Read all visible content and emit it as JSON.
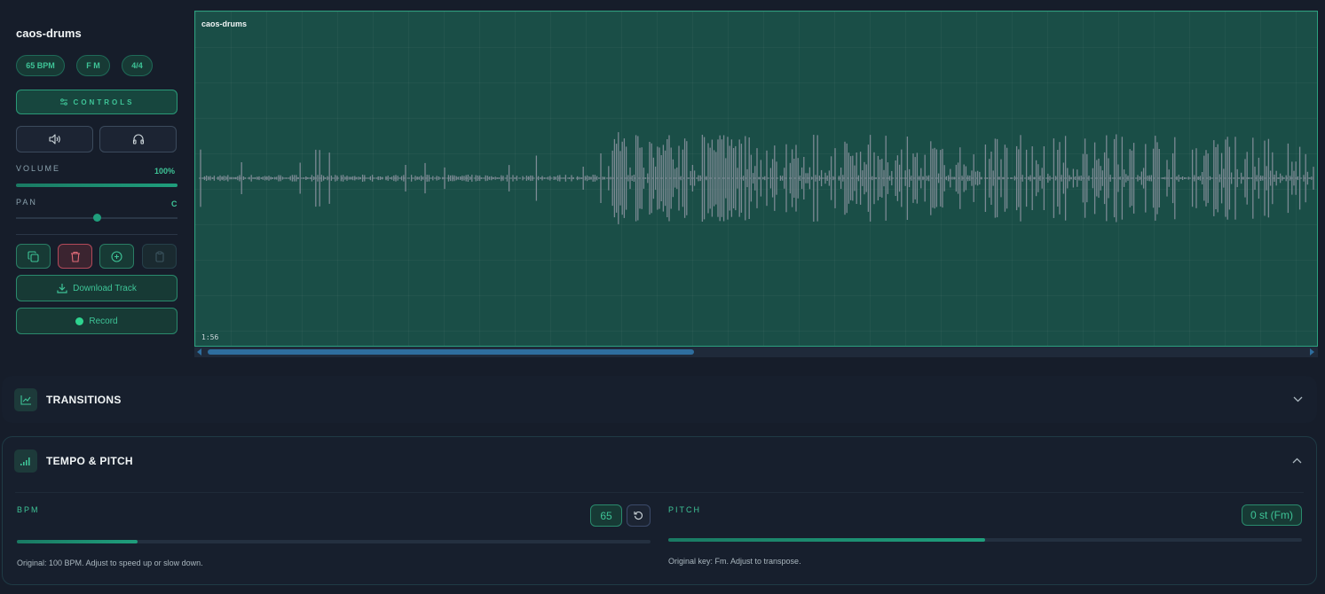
{
  "track": {
    "name": "caos-drums",
    "bpm_pill": "65 BPM",
    "key_pill": "F M",
    "time_sig_pill": "4/4",
    "controls_label": "CONTROLS",
    "volume_label": "VOLUME",
    "volume_value": "100%",
    "volume_level": 1.0,
    "pan_label": "PAN",
    "pan_value": "C",
    "pan_level": 0.5,
    "download_label": "Download Track",
    "record_label": "Record"
  },
  "waveform": {
    "title": "caos-drums",
    "time": "1:56"
  },
  "transitions": {
    "title": "TRANSITIONS"
  },
  "tempo_pitch": {
    "title": "TEMPO & PITCH",
    "bpm_label": "BPM",
    "bpm_value": "65",
    "bpm_level": 0.19,
    "bpm_help": "Original: 100 BPM. Adjust to speed up or slow down.",
    "pitch_label": "PITCH",
    "pitch_value": "0 st (Fm)",
    "pitch_level": 0.5,
    "pitch_help": "Original key: Fm. Adjust to transpose."
  },
  "colors": {
    "accent": "#3ec497",
    "panel": "#171f2d",
    "wave_bg": "#1a4e47",
    "wave_line": "#7c8a94",
    "danger": "#e06b78"
  }
}
